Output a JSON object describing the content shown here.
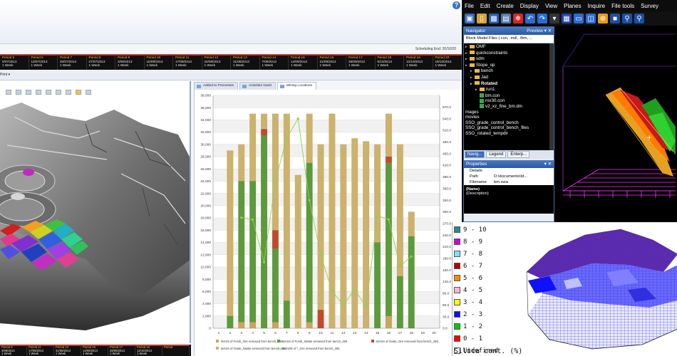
{
  "scheduler": {
    "scheduling_end": "Scheduling End: 20/10/20",
    "print_label": "Print ▾",
    "periods": [
      {
        "name": "Period 5",
        "date": "6/07/2013",
        "dur": "1 Week"
      },
      {
        "name": "Period 6",
        "date": "13/07/2013",
        "dur": "1 Week"
      },
      {
        "name": "Period 7",
        "date": "20/07/2013",
        "dur": "1 Week"
      },
      {
        "name": "Period 8",
        "date": "27/07/2013",
        "dur": "1 Week"
      },
      {
        "name": "Period 9",
        "date": "3/08/2013",
        "dur": "1 Week"
      },
      {
        "name": "Period 10",
        "date": "10/08/2013",
        "dur": "1 Week"
      },
      {
        "name": "Period 11",
        "date": "17/08/2013",
        "dur": "1 Week"
      },
      {
        "name": "Period 12",
        "date": "24/08/2013",
        "dur": "1 Week"
      },
      {
        "name": "Period 13",
        "date": "31/08/2013",
        "dur": "1 Week"
      },
      {
        "name": "Period 14",
        "date": "7/09/2013",
        "dur": "1 Week"
      },
      {
        "name": "Period 15",
        "date": "14/09/2013",
        "dur": "1 Week"
      },
      {
        "name": "Period 16",
        "date": "21/09/2013",
        "dur": "1 Week"
      },
      {
        "name": "Period 17",
        "date": "28/09/2013",
        "dur": "1 Week"
      },
      {
        "name": "Period 18",
        "date": "5/10/2013",
        "dur": "1 Week"
      },
      {
        "name": "Period 19",
        "date": "12/10/2013",
        "dur": "1 Week"
      },
      {
        "name": "Period 20",
        "date": "19/10/2013",
        "dur": "1 Week"
      }
    ],
    "periods_bottom": [
      {
        "name": "Period 9",
        "date": "3/08/2013",
        "dur": "1 Week"
      },
      {
        "name": "Period 11",
        "date": "17/08/2013",
        "dur": "1 Week"
      },
      {
        "name": "Period 13",
        "date": "31/08/2013",
        "dur": "1 Week"
      },
      {
        "name": "Period 15",
        "date": "14/09/2013",
        "dur": "1 Week"
      },
      {
        "name": "Period 17",
        "date": "28/09/2013",
        "dur": "1 Week"
      },
      {
        "name": "Period 19",
        "date": "12/10/2013",
        "dur": "1 Week"
      },
      {
        "name": "Period",
        "date": "",
        "dur": ""
      }
    ],
    "tabs": [
      {
        "label": "Added to Processes"
      },
      {
        "label": "Activities Gantt"
      },
      {
        "label": "Mining Locations"
      }
    ]
  },
  "chart_data": {
    "type": "bar",
    "stacked": true,
    "categories": [
      1,
      2,
      3,
      4,
      5,
      6,
      7,
      8,
      9,
      10,
      11,
      12,
      13,
      14,
      15,
      16,
      17,
      18,
      19,
      20
    ],
    "ylim": [
      0,
      38000
    ],
    "ylim_right": [
      0,
      600
    ],
    "yticks": [
      0,
      2000,
      4000,
      6000,
      8000,
      10000,
      12000,
      14000,
      16000,
      18000,
      20000,
      22000,
      24000,
      26000,
      28000,
      30000,
      32000,
      34000,
      36000,
      38000
    ],
    "ytick_labels": [
      "0",
      "2,000",
      "4,000",
      "6,000",
      "8,000",
      "10,000",
      "12,000",
      "14,000",
      "16,000",
      "18,000",
      "20,000",
      "22,000",
      "24,000",
      "26,000",
      "28,000",
      "30,000",
      "32,000",
      "34,000",
      "36,000",
      "38,000"
    ],
    "yticks_right": [
      0,
      30,
      60,
      90,
      120,
      150,
      180,
      210,
      240,
      270,
      300,
      330,
      360,
      390,
      420,
      450,
      480,
      510,
      540,
      570
    ],
    "ytick_labels_right": [
      "0.0",
      "30.0",
      "60.0",
      "90.0",
      "120.0",
      "150.0",
      "180.0",
      "210.0",
      "240.0",
      "270.0",
      "300.0",
      "330.0",
      "360.0",
      "390.0",
      "420.0",
      "450.0",
      "480.0",
      "510.0",
      "540.0",
      "570.0"
    ],
    "grid": true,
    "legend_position": "bottom",
    "series": [
      {
        "name": "MASS of Fresh_Ore removed from bench_265",
        "color": "#c8a65a",
        "values": [
          0,
          0,
          1000,
          1000,
          0,
          1000,
          0,
          0,
          1000,
          0,
          0,
          0,
          0,
          0,
          0,
          2000,
          0,
          0,
          0,
          0
        ]
      },
      {
        "name": "MASS of Fresh_Waste removed from bench_265",
        "color": "#5c9a3a",
        "values": [
          0,
          2000,
          23000,
          23000,
          31500,
          12000,
          4500,
          0,
          26000,
          0,
          0,
          0,
          0,
          0,
          14000,
          25000,
          8500,
          15000,
          0,
          0
        ]
      },
      {
        "name": "MASS of Oxide_Ore removed from bench_265",
        "color": "#c14a28",
        "values": [
          0,
          0,
          0,
          0,
          1000,
          3000,
          0,
          0,
          0,
          3000,
          0,
          0,
          0,
          0,
          0,
          1000,
          0,
          0,
          0,
          0
        ]
      },
      {
        "name": "MASS of Oxide_Waste removed from bench_265",
        "color": "#cdb26b",
        "values": [
          0,
          27000,
          6000,
          11000,
          2500,
          19000,
          30500,
          25000,
          8000,
          27000,
          35000,
          30000,
          31000,
          30500,
          16000,
          7000,
          21500,
          4000,
          0,
          0
        ]
      }
    ],
    "line_series": {
      "name": "GRADE of *_Ore removed from bench_265",
      "color": "#8fd14f",
      "values": [
        null,
        null,
        285,
        280,
        170,
        380,
        490,
        540,
        330,
        190,
        95,
        60,
        100,
        55,
        290,
        280,
        160,
        185,
        null,
        null
      ]
    }
  },
  "mine_app": {
    "menu": [
      "File",
      "Edit",
      "Create",
      "Display",
      "View",
      "Planes",
      "Inquire",
      "File tools",
      "Survey"
    ],
    "navigator": {
      "title": "Navigator",
      "preview": "Preview",
      "path": "Block Model Files (.con, .mdl, .fbm, ...",
      "tree": [
        {
          "label": "OMF",
          "icon": "folder",
          "indent": 0,
          "bold": false
        },
        {
          "label": "quickconstraints",
          "icon": "folder",
          "indent": 0,
          "bold": false
        },
        {
          "label": "sdm",
          "icon": "folder",
          "indent": 0,
          "bold": false
        },
        {
          "label": "Stope_op",
          "icon": "folder",
          "indent": 0,
          "bold": false
        },
        {
          "label": "bench",
          "icon": "folder",
          "indent": 1,
          "bold": false
        },
        {
          "label": "Jad",
          "icon": "folder",
          "indent": 1,
          "bold": false
        },
        {
          "label": "Rotated",
          "icon": "folder",
          "indent": 1,
          "bold": true
        },
        {
          "label": "run1",
          "icon": "folder",
          "indent": 2,
          "bold": false
        },
        {
          "label": "bm.con",
          "icon": "file",
          "indent": 2,
          "bold": false
        },
        {
          "label": "nsr30.con",
          "icon": "file",
          "indent": 2,
          "bold": false
        },
        {
          "label": "v2_xz_fine_bm.dm",
          "icon": "file",
          "indent": 2,
          "bold": false
        },
        {
          "label": "mages",
          "icon": "",
          "indent": 0,
          "bold": false
        },
        {
          "label": "movies",
          "icon": "",
          "indent": 0,
          "bold": false
        },
        {
          "label": "SSO_grade_control_bench",
          "icon": "",
          "indent": 0,
          "bold": false
        },
        {
          "label": "SSO_grade_control_bench_files",
          "icon": "",
          "indent": 0,
          "bold": false
        },
        {
          "label": "SSO_rotated_tempdir",
          "icon": "",
          "indent": 0,
          "bold": false
        }
      ],
      "tabs": [
        "Navig...",
        "Legend",
        "Enterp..."
      ]
    },
    "properties": {
      "title": "Properties",
      "section": "Details",
      "rows": [
        {
          "k": "Path",
          "v": "D:\\documents\\Id..."
        },
        {
          "k": "Filename",
          "v": "bm.swa"
        }
      ],
      "name_label": "(Name)",
      "desc_label": "(Description)"
    }
  },
  "silica": {
    "title": "Silica cont. (%)",
    "legend": [
      {
        "label": "9 - 10",
        "color": "#2a8a8a"
      },
      {
        "label": "8 - 9",
        "color": "#d000d0"
      },
      {
        "label": "7 - 8",
        "color": "#7fe0ff"
      },
      {
        "label": "6 - 7",
        "color": "#b00000"
      },
      {
        "label": "5 - 6",
        "color": "#ff8c00"
      },
      {
        "label": "4 - 5",
        "color": "#f4b8c8"
      },
      {
        "label": "3 - 4",
        "color": "#ffff00"
      },
      {
        "label": "2 - 3",
        "color": "#1010ff"
      },
      {
        "label": "1 - 2",
        "color": "#00cc00"
      },
      {
        "label": "0 - 1",
        "color": "#ff0000"
      },
      {
        "label": "Undefined",
        "color": "#ffffff"
      }
    ]
  }
}
